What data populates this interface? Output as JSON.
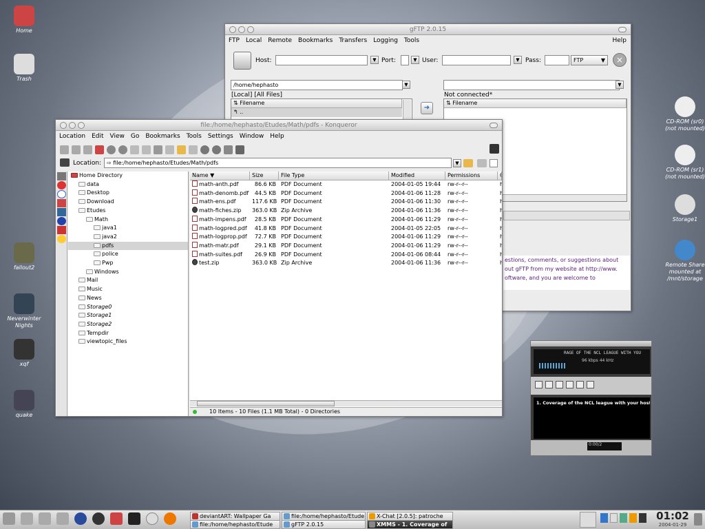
{
  "desktop": {
    "left_icons": [
      {
        "label": "Home"
      },
      {
        "label": "Trash"
      },
      {
        "label": "fallout2"
      },
      {
        "label": "Neverwinter Nights"
      },
      {
        "label": "xqf"
      },
      {
        "label": "quake"
      }
    ],
    "right_icons": [
      {
        "label": "CD-ROM (sr0) (not mounted)"
      },
      {
        "label": "CD-ROM (sr1) (not mounted)"
      },
      {
        "label": "Storage1"
      },
      {
        "label": "Remote Share mounted at /mnt/storage"
      }
    ]
  },
  "gftp": {
    "title": "gFTP 2.0.15",
    "menu": [
      "FTP",
      "Local",
      "Remote",
      "Bookmarks",
      "Transfers",
      "Logging",
      "Tools"
    ],
    "menu_help": "Help",
    "host_label": "Host:",
    "port_label": "Port:",
    "user_label": "User:",
    "pass_label": "Pass:",
    "protocol": "FTP",
    "local_path": "/home/hephasto",
    "local_filter": "[Local] [All Files]",
    "filename_header": "Filename",
    "local_rows": [
      ".."
    ],
    "remote_status": "Not connected*",
    "log_lines": [
      "estions, comments, or suggestions about",
      "out gFTP from my website at http://www.",
      "oftware, and you are welcome to"
    ]
  },
  "konq": {
    "title": "file:/home/hephasto/Etudes/Math/pdfs - Konqueror",
    "menu": [
      "Location",
      "Edit",
      "View",
      "Go",
      "Bookmarks",
      "Tools",
      "Settings",
      "Window",
      "Help"
    ],
    "location_label": "Location:",
    "location_value": "file:/home/hephasto/Etudes/Math/pdfs",
    "columns": [
      "Name",
      "Size",
      "File Type",
      "Modified",
      "Permissions",
      "O"
    ],
    "files": [
      {
        "name": "math-anth.pdf",
        "size": "86.6 KB",
        "type": "PDF Document",
        "modified": "2004-01-05 19:44",
        "perm": "rw-r--r--",
        "owner": "he",
        "kind": "pdf"
      },
      {
        "name": "math-denomb.pdf",
        "size": "44.5 KB",
        "type": "PDF Document",
        "modified": "2004-01-06 11:28",
        "perm": "rw-r--r--",
        "owner": "he",
        "kind": "pdf"
      },
      {
        "name": "math-ens.pdf",
        "size": "117.6 KB",
        "type": "PDF Document",
        "modified": "2004-01-06 11:30",
        "perm": "rw-r--r--",
        "owner": "he",
        "kind": "pdf"
      },
      {
        "name": "math-fiches.zip",
        "size": "363.0 KB",
        "type": "Zip Archive",
        "modified": "2004-01-06 11:36",
        "perm": "rw-r--r--",
        "owner": "he",
        "kind": "zip"
      },
      {
        "name": "math-impens.pdf",
        "size": "28.5 KB",
        "type": "PDF Document",
        "modified": "2004-01-06 11:29",
        "perm": "rw-r--r--",
        "owner": "he",
        "kind": "pdf"
      },
      {
        "name": "math-logpred.pdf",
        "size": "41.8 KB",
        "type": "PDF Document",
        "modified": "2004-01-05 22:05",
        "perm": "rw-r--r--",
        "owner": "he",
        "kind": "pdf"
      },
      {
        "name": "math-logprop.pdf",
        "size": "72.7 KB",
        "type": "PDF Document",
        "modified": "2004-01-06 11:29",
        "perm": "rw-r--r--",
        "owner": "he",
        "kind": "pdf"
      },
      {
        "name": "math-matr.pdf",
        "size": "29.1 KB",
        "type": "PDF Document",
        "modified": "2004-01-06 11:29",
        "perm": "rw-r--r--",
        "owner": "he",
        "kind": "pdf"
      },
      {
        "name": "math-suites.pdf",
        "size": "26.9 KB",
        "type": "PDF Document",
        "modified": "2004-01-06 08:44",
        "perm": "rw-r--r--",
        "owner": "he",
        "kind": "pdf"
      },
      {
        "name": "test.zip",
        "size": "363.0 KB",
        "type": "Zip Archive",
        "modified": "2004-01-06 11:36",
        "perm": "rw-r--r--",
        "owner": "he",
        "kind": "zip"
      }
    ],
    "tree": [
      {
        "label": "Home Directory",
        "depth": 0,
        "italic": false
      },
      {
        "label": "data",
        "depth": 1,
        "italic": false
      },
      {
        "label": "Desktop",
        "depth": 1,
        "italic": false
      },
      {
        "label": "Download",
        "depth": 1,
        "italic": false
      },
      {
        "label": "Etudes",
        "depth": 1,
        "italic": false
      },
      {
        "label": "Math",
        "depth": 2,
        "italic": false
      },
      {
        "label": "java1",
        "depth": 3,
        "italic": false
      },
      {
        "label": "java2",
        "depth": 3,
        "italic": false
      },
      {
        "label": "pdfs",
        "depth": 3,
        "italic": false,
        "selected": true
      },
      {
        "label": "police",
        "depth": 3,
        "italic": false
      },
      {
        "label": "Pwp",
        "depth": 3,
        "italic": false
      },
      {
        "label": "Windows",
        "depth": 2,
        "italic": false
      },
      {
        "label": "Mail",
        "depth": 1,
        "italic": false
      },
      {
        "label": "Music",
        "depth": 1,
        "italic": false
      },
      {
        "label": "News",
        "depth": 1,
        "italic": false
      },
      {
        "label": "Storage0",
        "depth": 1,
        "italic": true
      },
      {
        "label": "Storage1",
        "depth": 1,
        "italic": true
      },
      {
        "label": "Storage2",
        "depth": 1,
        "italic": true
      },
      {
        "label": "Tempdir",
        "depth": 1,
        "italic": false
      },
      {
        "label": "viewtopic_files",
        "depth": 1,
        "italic": false
      }
    ],
    "status": "10 Items - 10 Files (1.1 MB Total) - 0 Directories"
  },
  "xmms": {
    "scroller": "RAGE OF THE NCL LEAGUE WITH YOU",
    "kbps": "96",
    "khz": "44",
    "playlist_item": "1. Coverage of the NCL league with your host ...",
    "time": "0:00/2"
  },
  "taskbar": {
    "tasks": [
      {
        "label": "deviantART: Wallpaper Ga",
        "active": false,
        "color": "#b33"
      },
      {
        "label": "file:/home/hephasto/Etude",
        "active": false,
        "color": "#69c"
      },
      {
        "label": "X-Chat [2.0.5]: patroche",
        "active": false,
        "color": "#e90"
      },
      {
        "label": "file:/home/hephasto/Etude",
        "active": false,
        "color": "#69c"
      },
      {
        "label": "gFTP 2.0.15",
        "active": false,
        "color": "#69c"
      },
      {
        "label": "XMMS - 1. Coverage of",
        "active": true,
        "color": "#888"
      }
    ],
    "clock_time": "01:02",
    "clock_date": "2004-01-29"
  },
  "colors": {
    "selection": "#d4d4d4",
    "accent_blue": "#3a6ea5",
    "active_task": "#333333"
  }
}
